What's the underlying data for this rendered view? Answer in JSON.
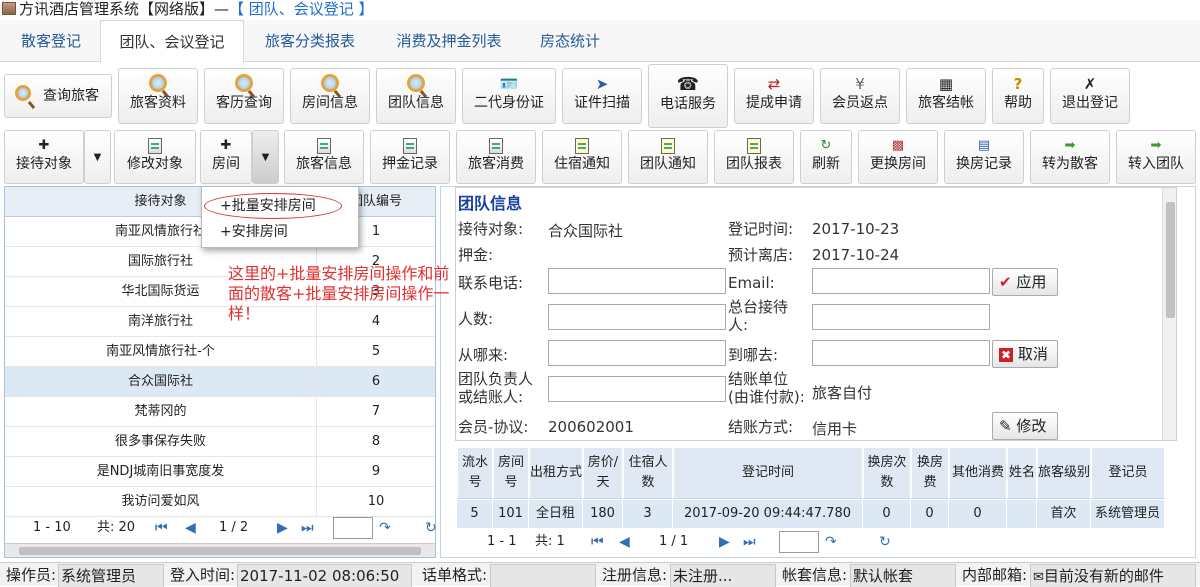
{
  "window": {
    "title": "方讯酒店管理系统【网络版】—",
    "subtitle": "【 团队、会议登记 】"
  },
  "tabs": [
    "散客登记",
    "团队、会议登记",
    "旅客分类报表",
    "消费及押金列表",
    "房态统计"
  ],
  "toolbar1": [
    {
      "label": "查询旅客",
      "icon": "search-icon"
    },
    {
      "label": "旅客资料",
      "icon": "search-icon"
    },
    {
      "label": "客历查询",
      "icon": "search-icon"
    },
    {
      "label": "房间信息",
      "icon": "search-icon"
    },
    {
      "label": "团队信息",
      "icon": "search-icon"
    },
    {
      "label": "二代身份证",
      "icon": "id-card-icon"
    },
    {
      "label": "证件扫描",
      "icon": "scanner-icon"
    },
    {
      "label": "电话服务",
      "icon": "telephone-icon"
    },
    {
      "label": "提成申请",
      "icon": "transfer-icon"
    },
    {
      "label": "会员返点",
      "icon": "yen-icon"
    },
    {
      "label": "旅客结帐",
      "icon": "calculator-icon"
    },
    {
      "label": "帮助",
      "icon": "help-icon"
    },
    {
      "label": "退出登记",
      "icon": "exit-icon"
    }
  ],
  "toolbar2": [
    {
      "label": "接待对象",
      "icon": "plus-icon"
    },
    {
      "label": "修改对象",
      "icon": "edit-icon"
    },
    {
      "label": "房间",
      "icon": "plus-icon"
    },
    {
      "label": "旅客信息",
      "icon": "guest-info-icon"
    },
    {
      "label": "押金记录",
      "icon": "deposit-icon"
    },
    {
      "label": "旅客消费",
      "icon": "consume-icon"
    },
    {
      "label": "住宿通知",
      "icon": "notice-icon"
    },
    {
      "label": "团队通知",
      "icon": "notice-icon"
    },
    {
      "label": "团队报表",
      "icon": "report-icon"
    },
    {
      "label": "刷新",
      "icon": "refresh-icon"
    },
    {
      "label": "更换房间",
      "icon": "change-room-icon"
    },
    {
      "label": "换房记录",
      "icon": "record-icon"
    },
    {
      "label": "转为散客",
      "icon": "arrow-right-icon"
    },
    {
      "label": "转入团队",
      "icon": "arrow-right-icon"
    }
  ],
  "dropdown_menu": [
    "批量安排房间",
    "安排房间"
  ],
  "dropdown_prefix": "+",
  "annotation": "这里的+批量安排房间操作和前面的散客+批量安排房间操作一样！",
  "left_table": {
    "headers": [
      "接待对象",
      "团队编号"
    ],
    "rows": [
      [
        "南亚风情旅行社",
        "1"
      ],
      [
        "国际旅行社",
        "2"
      ],
      [
        "华北国际货运",
        "3"
      ],
      [
        "南洋旅行社",
        "4"
      ],
      [
        "南亚风情旅行社-个",
        "5"
      ],
      [
        "合众国际社",
        "6"
      ],
      [
        "梵蒂冈的",
        "7"
      ],
      [
        "很多事保存失败",
        "8"
      ],
      [
        "是NDJ城南旧事宽度发",
        "9"
      ],
      [
        "我访问爱如风",
        "10"
      ]
    ],
    "pager": {
      "range": "1 - 10",
      "total": "共: 20",
      "page": "1 / 2"
    }
  },
  "group_info": {
    "title": "团队信息",
    "labels": {
      "reception": "接待对象:",
      "deposit": "押金:",
      "phone": "联系电话:",
      "people": "人数:",
      "from": "从哪来:",
      "leader": "团队负责人或结账人:",
      "member": "会员-协议:",
      "checkin": "登记时间:",
      "checkout": "预计离店:",
      "email": "Email:",
      "receptionist": "总台接待人:",
      "to": "到哪去:",
      "payer": "结账单位(由谁付款):",
      "payment": "结账方式:"
    },
    "values": {
      "reception": "合众国际社",
      "member": "200602001",
      "checkin": "2017-10-23",
      "checkout": "2017-10-24",
      "payer": "旅客自付",
      "payment": "信用卡"
    },
    "buttons": {
      "apply": "应用",
      "cancel": "取消",
      "modify": "修改"
    }
  },
  "room_grid": {
    "headers": [
      "流水号",
      "房间号",
      "出租方式",
      "房价/天",
      "住宿人数",
      "登记时间",
      "换房次数",
      "换房费",
      "其他消费",
      "姓名",
      "旅客级别",
      "登记员"
    ],
    "rows": [
      [
        "5",
        "101",
        "全日租",
        "180",
        "3",
        "2017-09-20 09:44:47.780",
        "0",
        "0",
        "0",
        "",
        "首次",
        "系统管理员"
      ]
    ],
    "pager": {
      "range": "1 - 1",
      "total": "共: 1",
      "page": "1 / 1"
    }
  },
  "status": {
    "operator_label": "操作员:",
    "operator": "系统管理员",
    "login_label": "登入时间:",
    "login": "2017-11-02 08:06:50",
    "phone_label": "话单格式:",
    "phone": "",
    "reg_label": "注册信息:",
    "reg": "未注册...",
    "account_label": "帐套信息:",
    "account": "默认帐套",
    "mail_label": "内部邮箱:",
    "mail": "目前没有新的邮件"
  }
}
